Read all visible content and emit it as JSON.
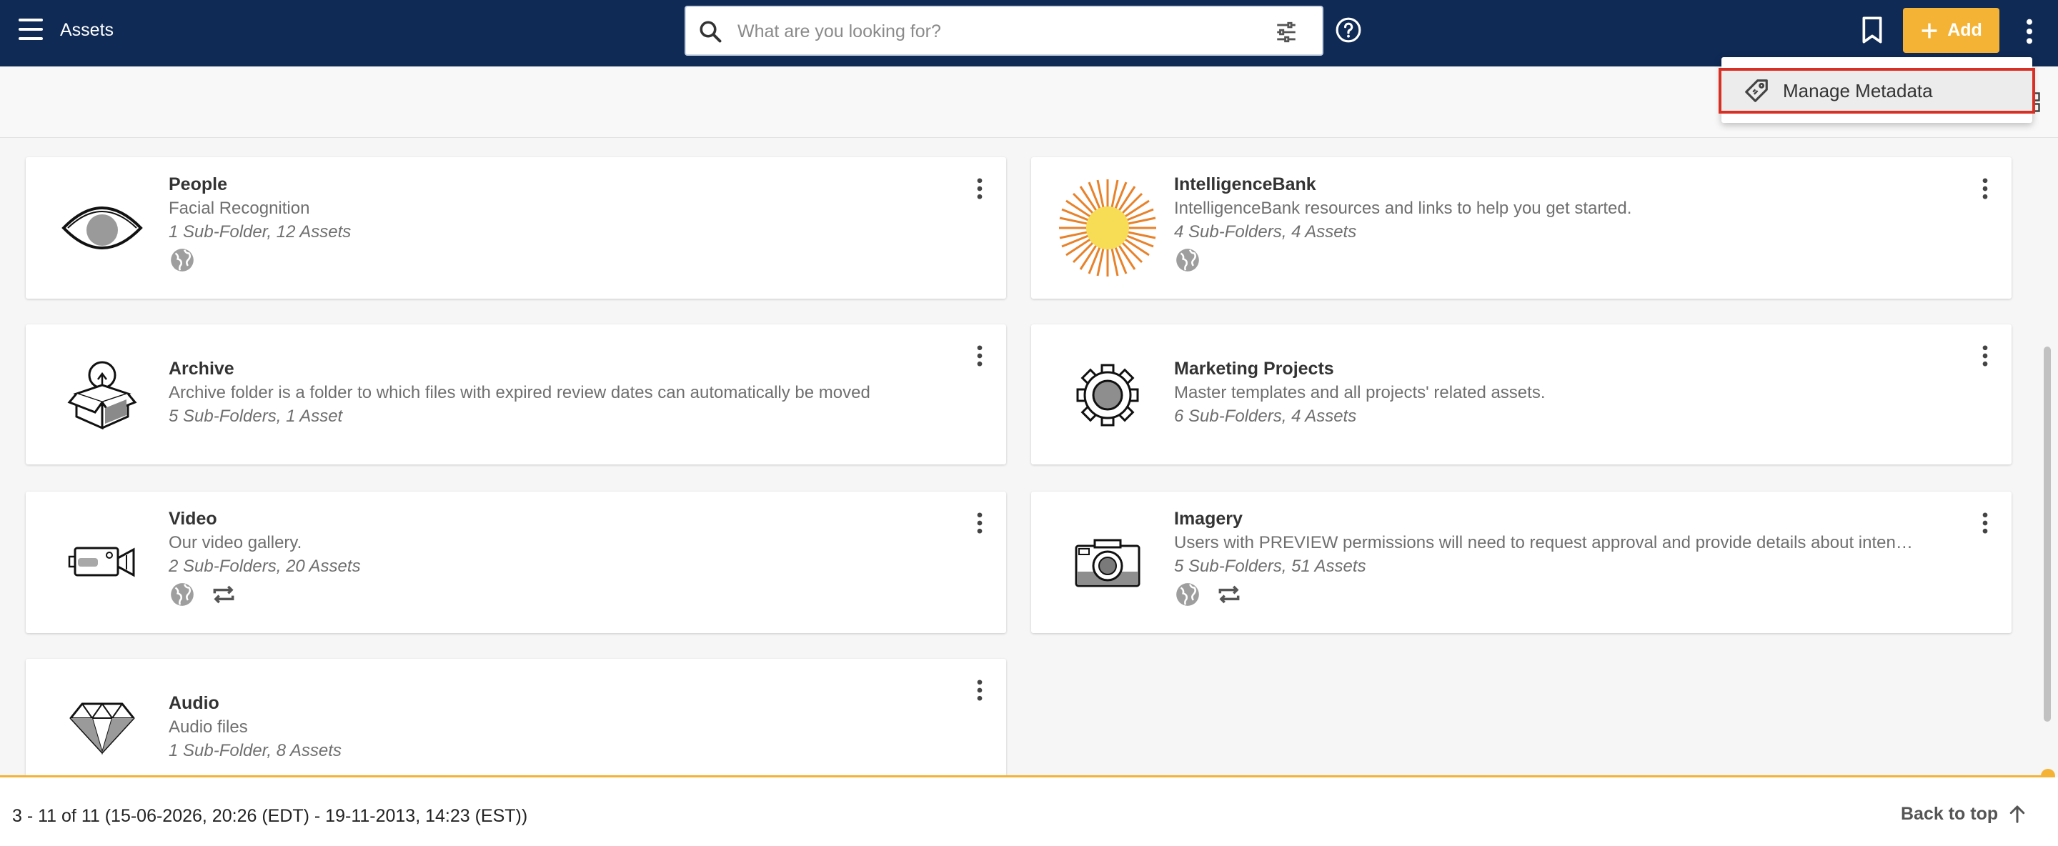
{
  "header": {
    "title": "Assets",
    "search_placeholder": "What are you looking for?",
    "add_label": "Add"
  },
  "menu": {
    "items": [
      {
        "label": "Manage Metadata",
        "icon": "tag-icon"
      }
    ]
  },
  "folders": [
    {
      "name": "People",
      "description": "Facial Recognition",
      "count": "1 Sub-Folder, 12 Assets",
      "thumb": "eye-icon",
      "badges": [
        "globe-icon"
      ]
    },
    {
      "name": "IntelligenceBank",
      "description": "IntelligenceBank resources and links to help you get started.",
      "count": "4 Sub-Folders, 4 Assets",
      "thumb": "sun-icon",
      "badges": [
        "globe-icon"
      ]
    },
    {
      "name": "Archive",
      "description": "Archive folder is a folder to which files with expired review dates can automatically be moved",
      "count": "5 Sub-Folders, 1 Asset",
      "thumb": "lightbulb-box-icon",
      "badges": []
    },
    {
      "name": "Marketing Projects",
      "description": "Master templates and all projects' related assets.",
      "count": "6 Sub-Folders, 4 Assets",
      "thumb": "gear-icon",
      "badges": []
    },
    {
      "name": "Video",
      "description": "Our video gallery.",
      "count": "2 Sub-Folders, 20 Assets",
      "thumb": "video-camera-icon",
      "badges": [
        "globe-icon",
        "repeat-icon"
      ]
    },
    {
      "name": "Imagery",
      "description": "Users with PREVIEW permissions will need to request approval and provide details about inten…",
      "count": "5 Sub-Folders, 51 Assets",
      "thumb": "photo-camera-icon",
      "badges": [
        "globe-icon",
        "repeat-icon"
      ]
    },
    {
      "name": "Audio",
      "description": "Audio files",
      "count": "1 Sub-Folder, 8 Assets",
      "thumb": "diamond-icon",
      "badges": []
    }
  ],
  "footer": {
    "range": "3 - 11 of 11 (15-06-2026, 20:26 (EDT) - 19-11-2013, 14:23 (EST))",
    "back_to_top": "Back to top"
  },
  "colors": {
    "header_bg": "#0f2a55",
    "accent": "#f5b335",
    "highlight": "#d93025"
  }
}
